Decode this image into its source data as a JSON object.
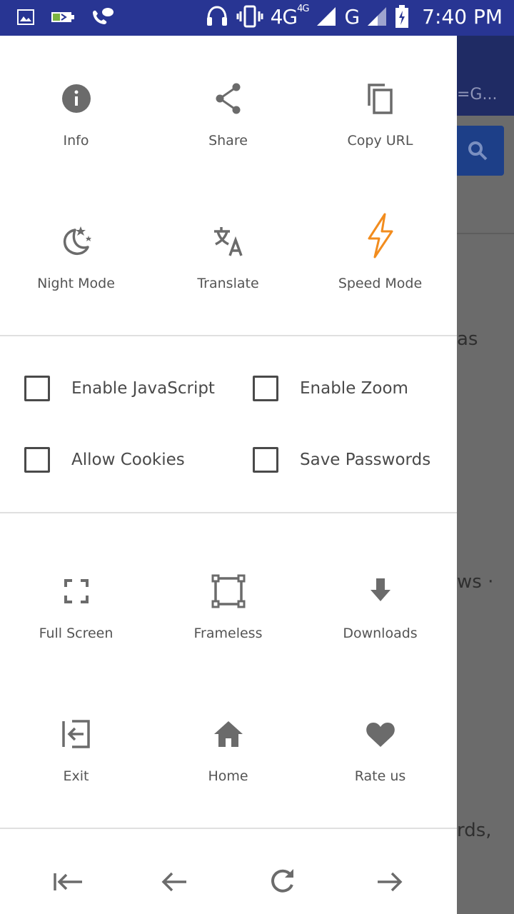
{
  "status_bar": {
    "network_label_4g": "4G",
    "network_sup_4g": "4G",
    "network_label_g": "G",
    "time": "7:40 PM",
    "icons": [
      "image-icon",
      "battery-charging-icon",
      "wifi-calling-icon",
      "headset-icon",
      "vibrate-icon",
      "signal-icon",
      "battery-icon"
    ]
  },
  "background_page": {
    "url_fragment": "=G...",
    "text_fragments": [
      "as",
      "ws ·",
      "rds,"
    ]
  },
  "drawer": {
    "top_grid": [
      {
        "label": "Info",
        "icon": "info-icon"
      },
      {
        "label": "Share",
        "icon": "share-icon"
      },
      {
        "label": "Copy URL",
        "icon": "copy-icon"
      },
      {
        "label": "Night Mode",
        "icon": "night-mode-icon"
      },
      {
        "label": "Translate",
        "icon": "translate-icon"
      },
      {
        "label": "Speed Mode",
        "icon": "flash-icon"
      }
    ],
    "checkboxes": [
      {
        "label": "Enable JavaScript",
        "checked": false
      },
      {
        "label": "Enable Zoom",
        "checked": false
      },
      {
        "label": "Allow Cookies",
        "checked": false
      },
      {
        "label": "Save Passwords",
        "checked": false
      }
    ],
    "bottom_grid": [
      {
        "label": "Full Screen",
        "icon": "fullscreen-icon"
      },
      {
        "label": "Frameless",
        "icon": "frame-icon"
      },
      {
        "label": "Downloads",
        "icon": "download-icon"
      },
      {
        "label": "Exit",
        "icon": "exit-icon"
      },
      {
        "label": "Home",
        "icon": "home-icon"
      },
      {
        "label": "Rate us",
        "icon": "heart-icon"
      }
    ],
    "nav_bar": [
      "first-page-icon",
      "back-arrow-icon",
      "refresh-icon",
      "forward-arrow-icon"
    ]
  },
  "colors": {
    "status_bar": "#283593",
    "icon_gray": "#6b6b6b",
    "accent_orange": "#f28c1e",
    "checkbox_border": "#4a4a4a"
  }
}
